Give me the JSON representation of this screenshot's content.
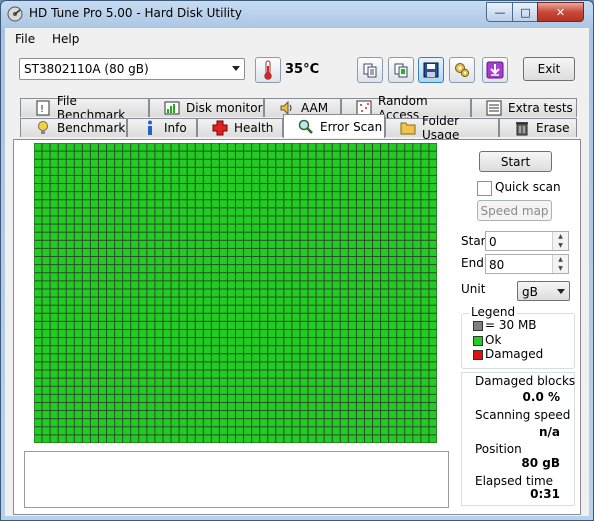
{
  "window": {
    "title": "HD Tune Pro 5.00 - Hard Disk Utility",
    "minimize": "—",
    "maximize": "□",
    "close": "✕"
  },
  "menu": {
    "file": "File",
    "help": "Help"
  },
  "toolbar": {
    "drive": "ST3802110A (80 gB)",
    "temperature": "35°C",
    "exit_label": "Exit"
  },
  "tabs_top": [
    {
      "label": "File Benchmark",
      "icon": "file-benchmark-icon"
    },
    {
      "label": "Disk monitor",
      "icon": "disk-monitor-icon"
    },
    {
      "label": "AAM",
      "icon": "speaker-icon"
    },
    {
      "label": "Random Access",
      "icon": "random-access-icon"
    },
    {
      "label": "Extra tests",
      "icon": "extra-tests-icon"
    }
  ],
  "tabs_bottom": [
    {
      "label": "Benchmark",
      "icon": "lightbulb-icon"
    },
    {
      "label": "Info",
      "icon": "info-icon"
    },
    {
      "label": "Health",
      "icon": "health-cross-icon"
    },
    {
      "label": "Error Scan",
      "icon": "magnifier-icon",
      "active": true
    },
    {
      "label": "Folder Usage",
      "icon": "folder-icon"
    },
    {
      "label": "Erase",
      "icon": "trash-icon"
    }
  ],
  "controls": {
    "start_button": "Start",
    "quick_scan": "Quick scan",
    "quick_scan_checked": false,
    "speed_map": "Speed map",
    "start_label": "Start",
    "start_value": "0",
    "end_label": "End",
    "end_value": "80",
    "unit_label": "Unit",
    "unit_value": "gB"
  },
  "legend": {
    "title": "Legend",
    "block_size": "= 30 MB",
    "ok": "Ok",
    "damaged": "Damaged",
    "colors": {
      "block": "#808080",
      "ok": "#22cc22",
      "damaged": "#dd1111"
    }
  },
  "stats": {
    "damaged_blocks_label": "Damaged blocks",
    "damaged_blocks_value": "0.0 %",
    "scanning_speed_label": "Scanning speed",
    "scanning_speed_value": "n/a",
    "position_label": "Position",
    "position_value": "80 gB",
    "elapsed_label": "Elapsed time",
    "elapsed_value": "0:31"
  },
  "scan_grid": {
    "columns": 50,
    "rows": 37,
    "block_color": "#22cc22"
  }
}
